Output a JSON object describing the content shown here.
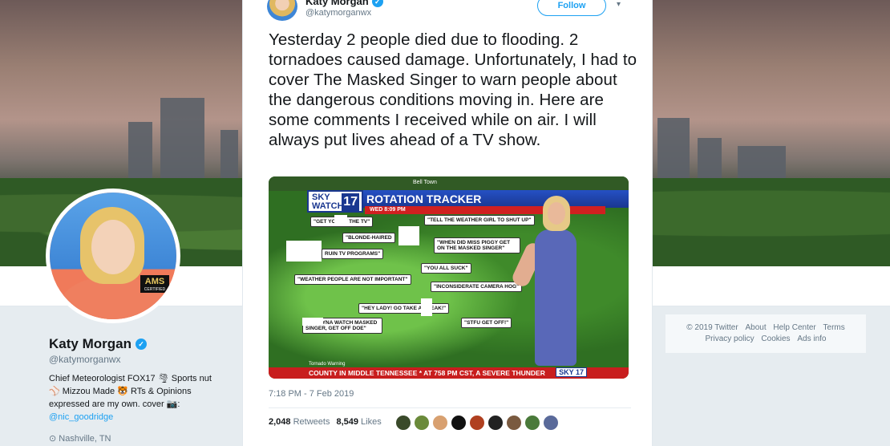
{
  "profile": {
    "name": "Katy Morgan",
    "handle": "@katymorganwx",
    "bio_line1": "Chief Meteorologist FOX17 🌪 Sports nut",
    "bio_line2": "⚾ Mizzou Made 🐯 RTs & Opinions",
    "bio_line3": "expressed are my own. cover 📷:",
    "bio_link": "@nic_goodridge",
    "location": "Nashville, TN",
    "avatar_badge": "AMS",
    "avatar_badge_sub": "CERTIFIED"
  },
  "footer": {
    "links": [
      "© 2019 Twitter",
      "About",
      "Help Center",
      "Terms",
      "Privacy policy",
      "Cookies",
      "Ads info"
    ]
  },
  "tweet": {
    "name": "Katy Morgan",
    "handle": "@katymorganwx",
    "follow_label": "Follow",
    "text": "Yesterday 2 people died due to flooding.  2 tornadoes caused damage.  Unfortunately, I had to cover The Masked Singer to warn people about the dangerous conditions moving in.  Here are some comments I received while on air.  I will always put lives ahead of a TV show.",
    "timestamp": "7:18 PM - 7 Feb 2019",
    "retweets_count": "2,048",
    "retweets_label": "Retweets",
    "likes_count": "8,549",
    "likes_label": "Likes"
  },
  "tv": {
    "top_label": "Bell Town",
    "logo_text": "SKY WATCH",
    "logo_num": "17",
    "banner": "ROTATION TRACKER",
    "sub": "WED 8:09 PM",
    "warning": "Tornado Warning",
    "ticker": "COUNTY IN MIDDLE TENNESSEE * AT 758 PM CST, A SEVERE THUNDER",
    "ticker_logo": "SKY 17",
    "comments": [
      "\"GET YO      OFF THE TV\"",
      "\"BLONDE-HAIRED",
      "RUIN TV PROGRAMS\"",
      "\"WEATHER PEOPLE ARE NOT IMPORTANT\"",
      "\"HEY LADY! GO TAKE A      BREAK!\"",
      "WE TRYNA WATCH MASKED SINGER, GET OFF DOE\"",
      "\"TELL THE WEATHER GIRL TO SHUT UP\"",
      "\"WHEN DID MISS PIGGY GET ON THE MASKED SINGER\"",
      "\"YOU ALL SUCK\"",
      "\"INCONSIDERATE CAMERA HOG\"",
      "\"STFU GET OFF!\""
    ]
  },
  "colors": {
    "accent": "#1da1f2",
    "background": "#e6ecf0",
    "ticker_red": "#c81e1e",
    "banner_blue": "#2550c4"
  }
}
